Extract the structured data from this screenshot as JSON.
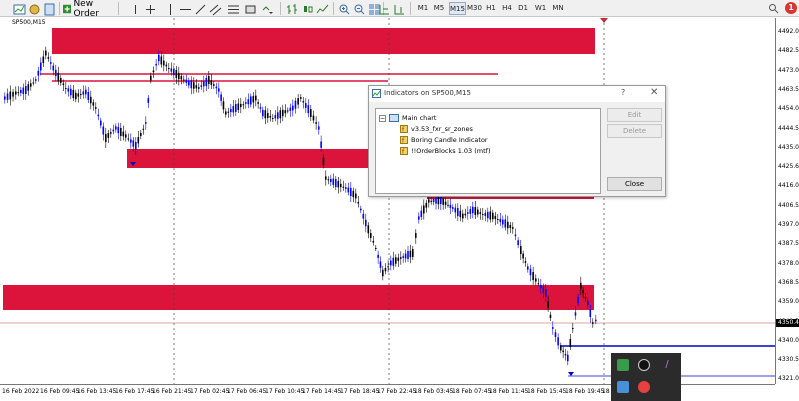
{
  "toolbar": {
    "new_order_label": "New Order",
    "timeframes": [
      "M1",
      "M5",
      "M15",
      "M30",
      "H1",
      "H4",
      "D1",
      "W1",
      "MN"
    ],
    "active_timeframe": "M15",
    "alert_count": "1"
  },
  "chart": {
    "symbol": "SP500,M15",
    "current_price": "4350.4",
    "price_labels": [
      "4492.0",
      "4482.5",
      "4473.0",
      "4463.5",
      "4454.0",
      "4444.5",
      "4435.0",
      "4425.6",
      "4416.0",
      "4406.5",
      "4397.0",
      "4387.5",
      "4378.0",
      "4368.5",
      "4359.0",
      "4349.5",
      "4340.0",
      "4330.5",
      "4321.0"
    ],
    "time_labels": [
      "16 Feb 2022",
      "16 Feb 09:45",
      "16 Feb 13:45",
      "16 Feb 17:45",
      "16 Feb 21:45",
      "17 Feb 02:45",
      "17 Feb 06:45",
      "17 Feb 10:45",
      "17 Feb 14:45",
      "17 Feb 18:45",
      "17 Feb 22:45",
      "18 Feb 03:45",
      "18 Feb 07:45",
      "18 Feb 11:45",
      "18 Feb 15:45",
      "18 Feb 19:45",
      "18"
    ],
    "colors": {
      "zone": "#dc143c",
      "bull": "#000000",
      "bear": "#0000ff",
      "hline": "#0000cd"
    }
  },
  "dialog": {
    "title": "Indicators on SP500,M15",
    "help": "?",
    "root_label": "Main chart",
    "indicators": [
      "v3.53_fxr_sr_zones",
      "Boring Candle Indicator",
      "!!OrderBlocks 1.03 (mtf)"
    ],
    "edit_label": "Edit",
    "delete_label": "Delete",
    "close_label": "Close"
  }
}
